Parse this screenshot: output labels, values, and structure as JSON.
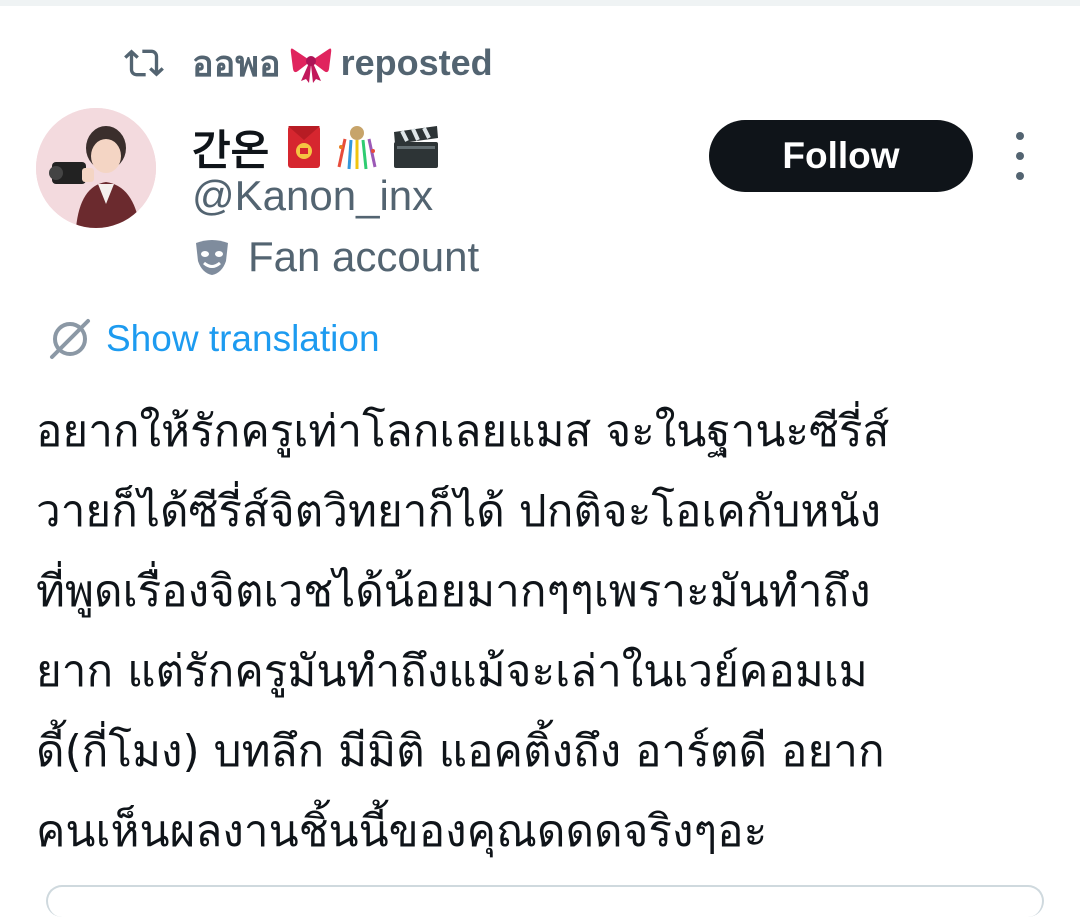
{
  "repost": {
    "user": "ออพอ",
    "label": "reposted",
    "icon": "repost-icon",
    "badge_icon": "ribbon-icon"
  },
  "profile": {
    "display_name": "간온",
    "badges": [
      "red-envelope-icon",
      "confetti-icon",
      "clapperboard-icon"
    ],
    "handle": "@Kanon_inx",
    "account_label": "Fan account",
    "account_icon": "theater-mask-icon",
    "avatar": "avatar-photo"
  },
  "actions": {
    "follow_label": "Follow",
    "more_icon": "more-vertical-icon"
  },
  "translate": {
    "label": "Show translation",
    "icon": "translate-globe-icon"
  },
  "tweet": {
    "lines": [
      "อยากให้รักครูเท่าโลกเลยแมส จะในฐานะซีรี่ส์",
      "วายก็ได้ซีรี่ส์จิตวิทยาก็ได้ ปกติจะโอเคกับหนัง",
      "ที่พูดเรื่องจิตเวชได้น้อยมากๆๆเพราะมันทำถึง",
      "ยาก แต่รักครูมันทำถึงแม้จะเล่าในเวย์คอมเม",
      "ดี้(กี่โมง) บทลึก มีมิติ แอคติ้งถึง อาร์ตดี อยาก",
      "คนเห็นผลงานชิ้นนี้ของคุณดดดจริงๆอะ"
    ]
  },
  "colors": {
    "text_primary": "#0f1419",
    "text_secondary": "#536471",
    "link": "#1d9bf0",
    "button_bg": "#0f1419",
    "button_text": "#ffffff",
    "divider": "#eff3f4"
  }
}
